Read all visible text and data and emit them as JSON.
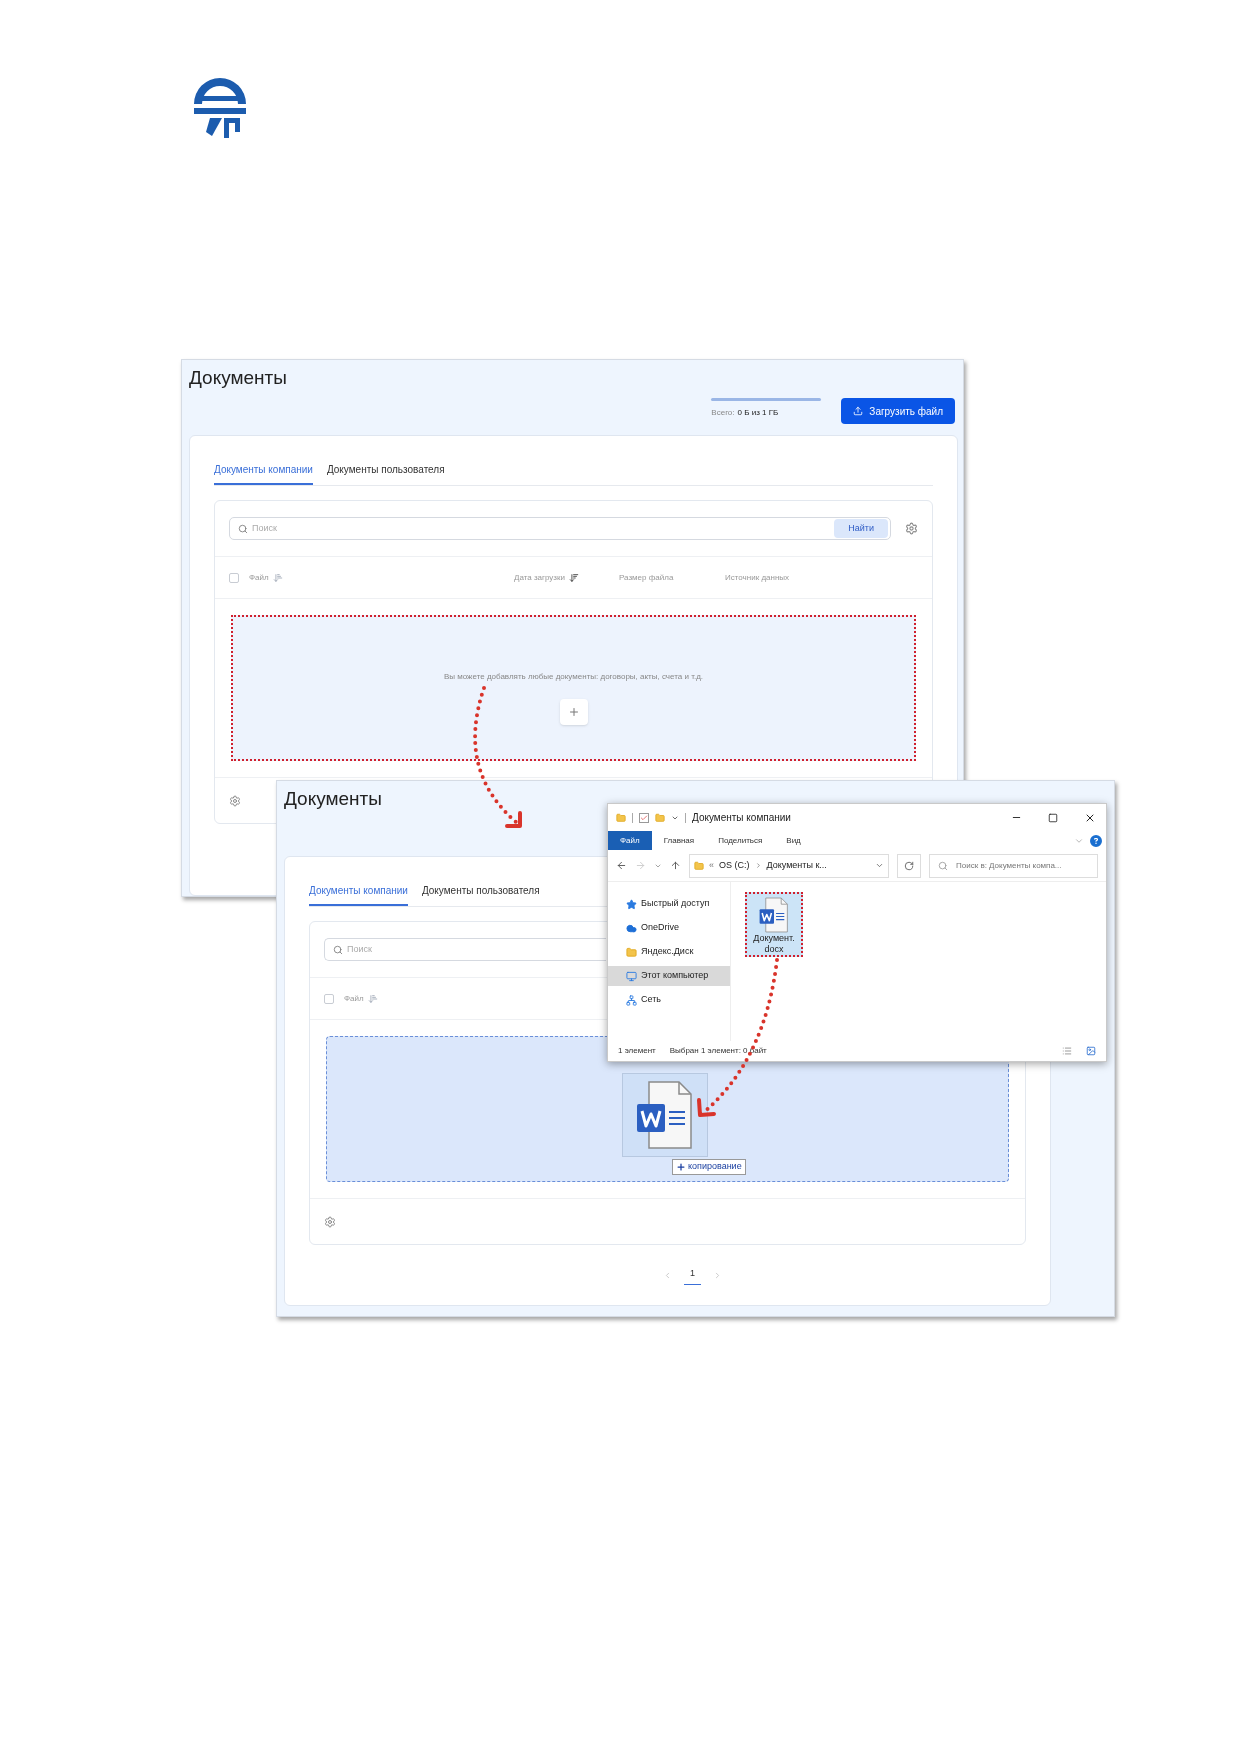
{
  "screenshot_1": {
    "title": "Документы",
    "storage": {
      "label": "Всего:",
      "value": "0 Б из 1 ГБ",
      "level": 0
    },
    "upload_button": "Загрузить файл",
    "tabs": [
      {
        "label": "Документы компании",
        "selected": true
      },
      {
        "label": "Документы пользователя",
        "selected": false
      }
    ],
    "search": {
      "placeholder": "Поиск",
      "button": "Найти"
    },
    "select_all": {
      "checked": false
    },
    "columns": [
      {
        "label": "Файл",
        "kind": "sortable"
      },
      {
        "label": "Дата загрузки",
        "kind": "sorted"
      },
      {
        "label": "Размер файла",
        "kind": "plain"
      },
      {
        "label": "Источник данных",
        "kind": "plain"
      }
    ],
    "dropzone": {
      "text": "Вы можете добавлять любые документы: договоры, акты, счета и т.д.",
      "drag_over": false,
      "marked": true
    }
  },
  "screenshot_2": {
    "title": "Документы",
    "tabs": [
      {
        "label": "Документы компании",
        "selected": true
      },
      {
        "label": "Документы пользователя",
        "selected": false
      }
    ],
    "search": {
      "placeholder": "Поиск"
    },
    "select_all": {
      "checked": false
    },
    "columns": [
      {
        "label": "Файл",
        "kind": "sortable"
      }
    ],
    "dropzone": {
      "drag_over": true,
      "marked": false
    },
    "pagination": {
      "pages": [
        {
          "label": "1",
          "selected": true
        }
      ]
    }
  },
  "explorer": {
    "title": "Документы компании",
    "ribbon_tabs": [
      {
        "label": "Файл",
        "selected": true
      },
      {
        "label": "Главная",
        "selected": false
      },
      {
        "label": "Поделиться",
        "selected": false
      },
      {
        "label": "Вид",
        "selected": false
      }
    ],
    "address": {
      "overflow": "«",
      "path": [
        "OS (C:)",
        "Документы к..."
      ]
    },
    "search": {
      "placeholder": "Поиск в: Документы компа..."
    },
    "nav": [
      {
        "label": "Быстрый доступ",
        "kind": "star",
        "selected": false
      },
      {
        "label": "OneDrive",
        "kind": "cloud",
        "selected": false
      },
      {
        "label": "Яндекс.Диск",
        "kind": "folder",
        "selected": false
      },
      {
        "label": "Этот компьютер",
        "kind": "computer",
        "selected": true
      },
      {
        "label": "Сеть",
        "kind": "network",
        "selected": false
      }
    ],
    "files": [
      {
        "name_lines": [
          "Документ.",
          "docx"
        ],
        "selected": true,
        "marked": true
      }
    ],
    "status": [
      "1 элемент",
      "Выбран 1 элемент: 0 байт"
    ]
  },
  "drag": {
    "label": "копирование"
  }
}
